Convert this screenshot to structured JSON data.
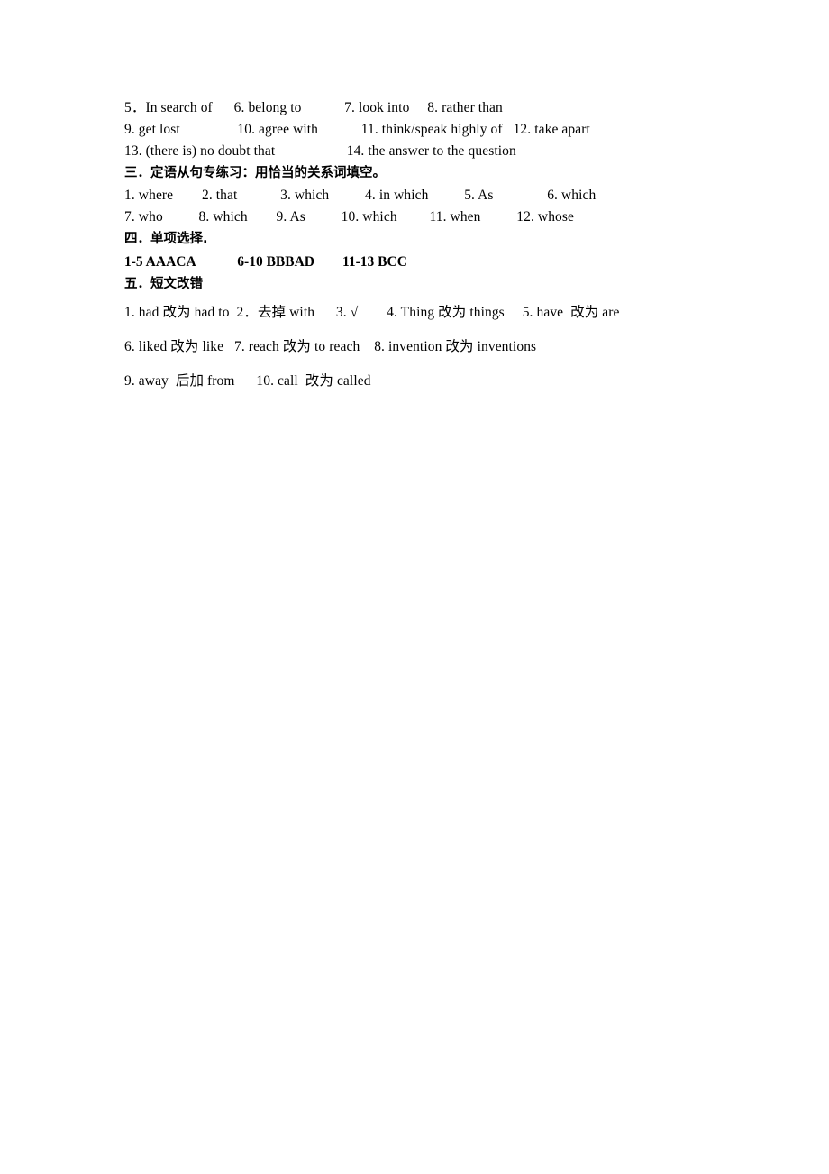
{
  "document": {
    "lines": [
      {
        "id": "line-1",
        "style": "plain",
        "text": "5．In search of      6. belong to            7. look into     8. rather than"
      },
      {
        "id": "line-2",
        "style": "plain",
        "text": "9. get lost                10. agree with            11. think/speak highly of   12. take apart"
      },
      {
        "id": "line-3",
        "style": "plain",
        "text": "13. (there is) no doubt that                    14. the answer to the question"
      },
      {
        "id": "heading-3",
        "style": "heading",
        "text": "三．定语从句专练习：用恰当的关系词填空。"
      },
      {
        "id": "line-4",
        "style": "plain",
        "text": "1. where        2. that            3. which          4. in which          5. As               6. which"
      },
      {
        "id": "line-5",
        "style": "plain",
        "text": "7. who          8. which        9. As          10. which         11. when          12. whose"
      },
      {
        "id": "heading-4",
        "style": "heading",
        "text": "四．单项选择."
      },
      {
        "id": "line-6",
        "style": "bold",
        "text": "1-5 AAACA            6-10 BBBAD        11-13 BCC"
      },
      {
        "id": "heading-5",
        "style": "heading",
        "text": "五．短文改错"
      },
      {
        "id": "line-7",
        "style": "spaced",
        "text": "1. had 改为 had to  2．去掉 with      3. √        4. Thing 改为 things     5. have  改为 are"
      },
      {
        "id": "line-8",
        "style": "spaced",
        "text": "6. liked 改为 like   7. reach 改为 to reach    8. invention 改为 inventions"
      },
      {
        "id": "line-9",
        "style": "spaced",
        "text": "9. away  后加 from      10. call  改为 called"
      }
    ]
  }
}
